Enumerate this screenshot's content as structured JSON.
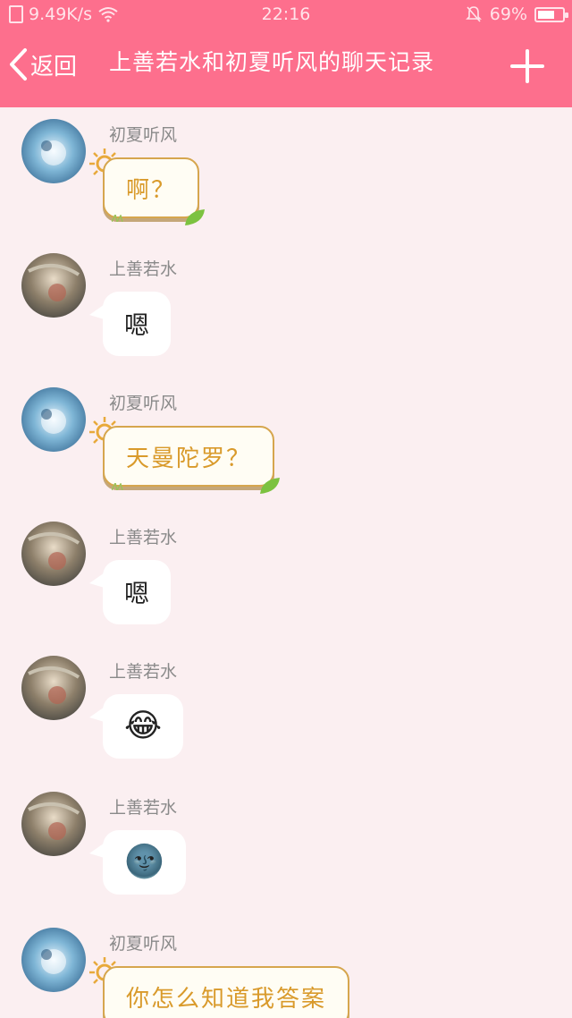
{
  "status_bar": {
    "network_speed": "9.49K/s",
    "time": "22:16",
    "battery_text": "69%",
    "battery_level": 0.69
  },
  "header": {
    "back_label": "返回",
    "title": "上善若水和初夏听风的聊天记录"
  },
  "messages": [
    {
      "sender": "初夏听风",
      "text": "啊？",
      "style": "fancy"
    },
    {
      "sender": "上善若水",
      "text": "嗯",
      "style": "plain"
    },
    {
      "sender": "初夏听风",
      "text": "天曼陀罗？",
      "style": "fancy"
    },
    {
      "sender": "上善若水",
      "text": "嗯",
      "style": "plain"
    },
    {
      "sender": "上善若水",
      "text": "😂",
      "style": "plain-emoji"
    },
    {
      "sender": "上善若水",
      "text": "🌚",
      "style": "plain-emoji"
    },
    {
      "sender": "初夏听风",
      "text": "你怎么知道我答案",
      "style": "fancy"
    }
  ],
  "colors": {
    "accent": "#fd6f8d",
    "background": "#fbeff1",
    "fancy_text": "#d99a2b"
  }
}
